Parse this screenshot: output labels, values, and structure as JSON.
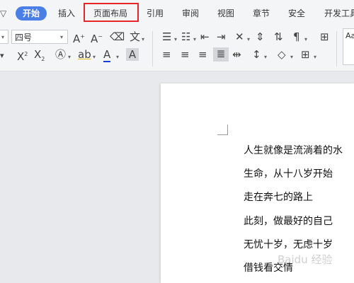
{
  "tabs": {
    "menu_caret": "▽",
    "start": "开始",
    "insert": "插入",
    "page_layout": "页面布局",
    "references": "引用",
    "review": "审阅",
    "view": "视图",
    "chapter": "章节",
    "security": "安全",
    "dev_tools": "开发工具"
  },
  "toolbar": {
    "font_size": "四号",
    "styles_preview": "Aa"
  },
  "document": {
    "lines": [
      "人生就像是流淌着的水",
      "生命，从十八岁开始",
      "走在奔七的路上",
      "此刻，做最好的自己",
      "无忧十岁，无虑十岁",
      "借钱看交情"
    ]
  },
  "watermark": "Baidu 经验",
  "colors": {
    "accent": "#4a7fe6",
    "highlight": "#e8262a",
    "font_color": "#1a3fd6"
  }
}
